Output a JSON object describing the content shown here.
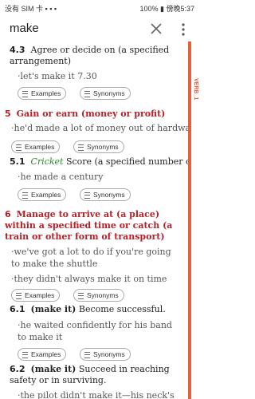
{
  "status": {
    "left": "没有 SIM 卡 ▪ ▪ ▪",
    "right": "100% ▮ 傍晚5:37"
  },
  "search": {
    "query": "make"
  },
  "side": {
    "label": "VERB_1"
  },
  "senses": [
    {
      "id": "4.3",
      "text": "Agree or decide on (a specified arrangement)"
    },
    {
      "id": "5",
      "text": "Gain or earn (money or profit)"
    },
    {
      "id": "5.1",
      "domain": "Cricket",
      "text": "Score (a specified number of runs)"
    },
    {
      "id": "6",
      "text": "Manage to arrive at (a place) within a specified time or catch (a train or other form of transport)"
    },
    {
      "id": "6.1",
      "phrase": "(make it)",
      "text": "Become successful."
    },
    {
      "id": "6.2",
      "phrase": "(make it)",
      "text": "Succeed in reaching safety or in surviving."
    }
  ],
  "examples": [
    "·let's make it 7.30",
    "·he'd made a lot of money out of hardware",
    "·he made a century",
    "·we've got a lot to do if you're going to make the shuttle",
    "·they didn't always make it on time",
    "·he waited confidently for his band to make it",
    "·the pilot didn't make it—his neck's"
  ],
  "buttons": {
    "examples": "Examples",
    "synonyms": "Synonyms"
  }
}
